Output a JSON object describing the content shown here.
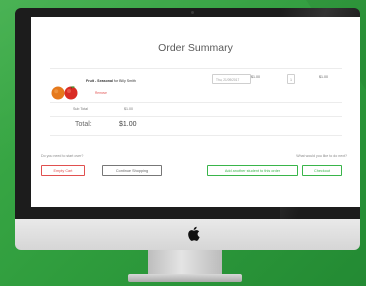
{
  "order": {
    "title": "Order Summary",
    "item": {
      "name_bold": "Fruit - Seasonal",
      "name_rest": " for Billy Smith",
      "remove_label": "Remove",
      "date_placeholder": "Thu, 21/09/2017",
      "unit_price": "$1.00",
      "quantity": "1",
      "line_price": "$1.00"
    },
    "subtotal_label": "Sub Total",
    "subtotal_value": "$1.00",
    "total_label": "Total:",
    "total_value": "$1.00"
  },
  "actions": {
    "left_question": "Do you need to start over?",
    "right_question": "What would you like to do next?",
    "empty_cart": "Empty Cart",
    "continue_shopping": "Continue Shopping",
    "add_student": "Add another student to this order",
    "checkout": "Checkout"
  },
  "colors": {
    "accent_green": "#39b54a",
    "danger_red": "#e0504f",
    "background_green": "#2e9b3c"
  }
}
